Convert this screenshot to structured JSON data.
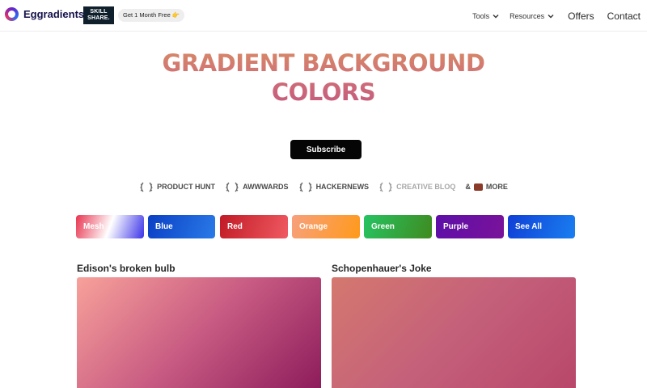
{
  "brand": {
    "name": "Eggradients",
    "sponsor_line1": "SKILL",
    "sponsor_line2": "SHARE.",
    "promo": "Get 1 Month Free 👉"
  },
  "nav": {
    "tools": "Tools",
    "resources": "Resources",
    "offers": "Offers",
    "contact": "Contact"
  },
  "hero": {
    "title": "GRADIENT BACKGROUND COLORS",
    "subscribe": "Subscribe"
  },
  "press": {
    "items": [
      "PRODUCT HUNT",
      "AWWWARDS",
      "HACKERNEWS",
      "CREATIVE BLOQ"
    ],
    "more_prefix": "&",
    "more": "MORE"
  },
  "categories": [
    {
      "label": "Mesh",
      "colors": [
        "#e8344f",
        "#ffffff",
        "#3b33e8"
      ]
    },
    {
      "label": "Blue",
      "colors": [
        "#0a3fc4",
        "#2a7ae8"
      ]
    },
    {
      "label": "Red",
      "colors": [
        "#c01a25",
        "#f05a62"
      ]
    },
    {
      "label": "Orange",
      "colors": [
        "#f7a07d",
        "#ff9a1a"
      ]
    },
    {
      "label": "Green",
      "colors": [
        "#26c462",
        "#3f8a1f"
      ]
    },
    {
      "label": "Purple",
      "colors": [
        "#5d0fa8",
        "#7a129a"
      ]
    },
    {
      "label": "See All",
      "colors": [
        "#0f3fd6",
        "#1a7ff0"
      ]
    }
  ],
  "gradients": [
    {
      "title": "Edison's broken bulb",
      "colors": [
        "#f8a19a",
        "#c75a82",
        "#8b1a5a"
      ]
    },
    {
      "title": "Schopenhauer's Joke",
      "colors": [
        "#d4786f",
        "#c4607a",
        "#b8466a"
      ]
    }
  ]
}
